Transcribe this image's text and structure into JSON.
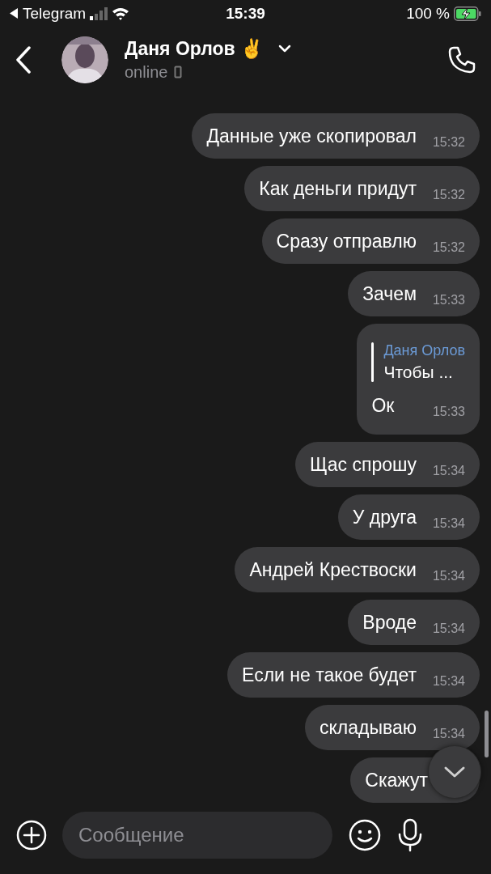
{
  "status_bar": {
    "back_app": "Telegram",
    "time": "15:39",
    "battery": "100 %",
    "charging": true
  },
  "header": {
    "name": "Даня Орлов ✌️",
    "status": "online"
  },
  "messages": [
    {
      "kind": "text",
      "text": "Данные уже скопировал",
      "time": "15:32"
    },
    {
      "kind": "text",
      "text": "Как деньги придут",
      "time": "15:32"
    },
    {
      "kind": "text",
      "text": "Сразу отправлю",
      "time": "15:32"
    },
    {
      "kind": "text",
      "text": "Зачем",
      "time": "15:33"
    },
    {
      "kind": "reply",
      "reply_author": "Даня Орлов",
      "reply_text": "Чтобы ...",
      "text": "Ок",
      "time": "15:33"
    },
    {
      "kind": "text",
      "text": "Щас спрошу",
      "time": "15:34"
    },
    {
      "kind": "text",
      "text": "У друга",
      "time": "15:34"
    },
    {
      "kind": "text",
      "text": "Андрей Крествоски",
      "time": "15:34"
    },
    {
      "kind": "text",
      "text": "Вроде",
      "time": "15:34"
    },
    {
      "kind": "text",
      "text": "Если не такое будет",
      "time": "15:34"
    },
    {
      "kind": "text",
      "text": "складываю",
      "time": "15:34"
    },
    {
      "kind": "text",
      "text": "Скажут"
    }
  ],
  "composer": {
    "placeholder": "Сообщение"
  }
}
